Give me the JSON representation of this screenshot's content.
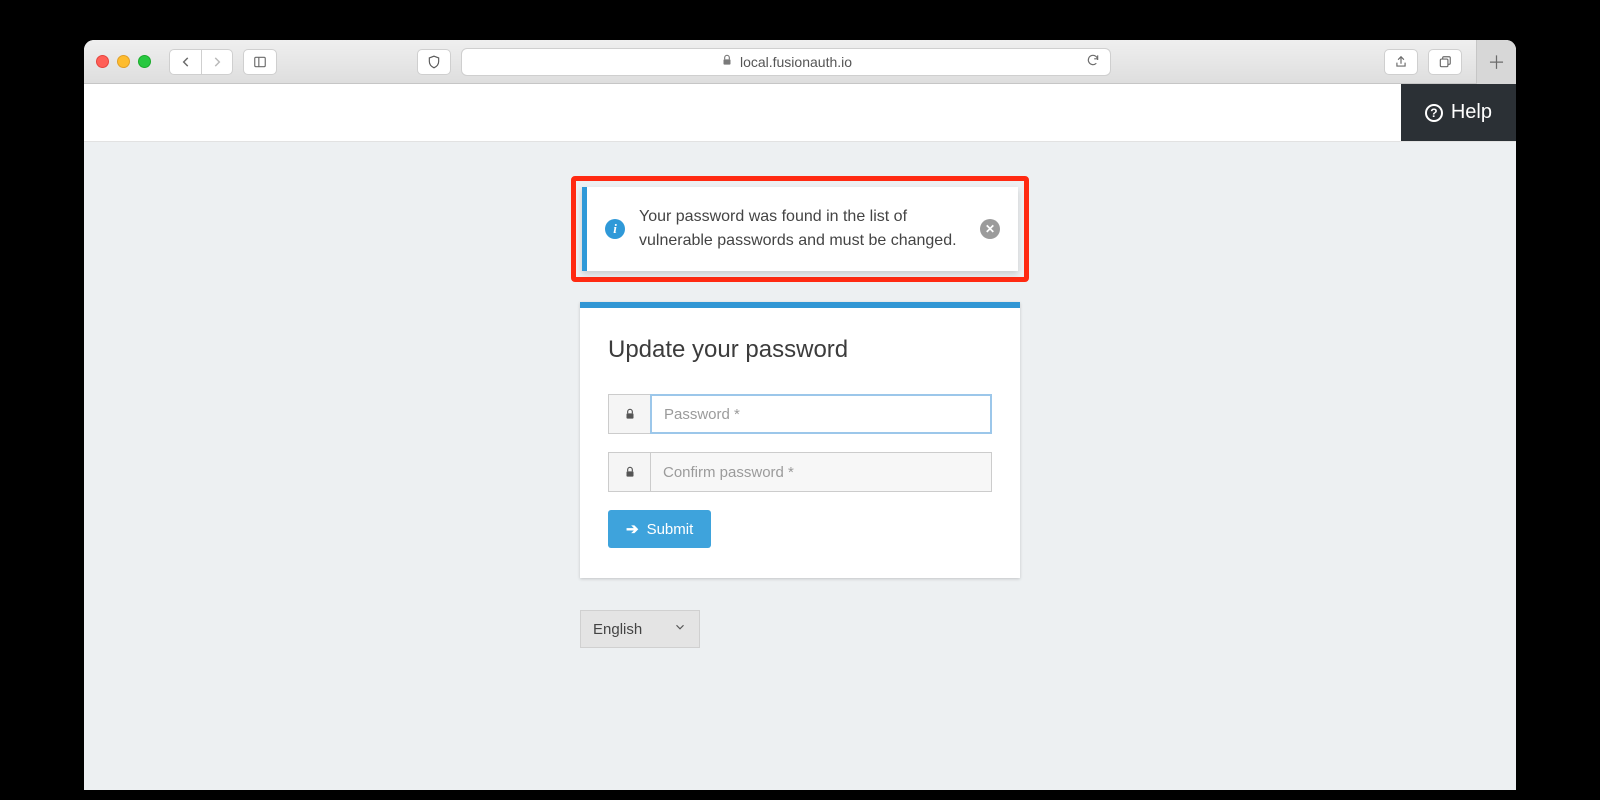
{
  "browser": {
    "address": "local.fusionauth.io"
  },
  "header": {
    "help_label": "Help"
  },
  "alert": {
    "message": "Your password was found in the list of vulnerable passwords and must be changed."
  },
  "form": {
    "title": "Update your password",
    "password_placeholder": "Password *",
    "confirm_placeholder": "Confirm password *",
    "submit_label": "Submit"
  },
  "footer": {
    "language": "English"
  },
  "colors": {
    "accent": "#3096d4",
    "highlight": "#ff2a12"
  }
}
